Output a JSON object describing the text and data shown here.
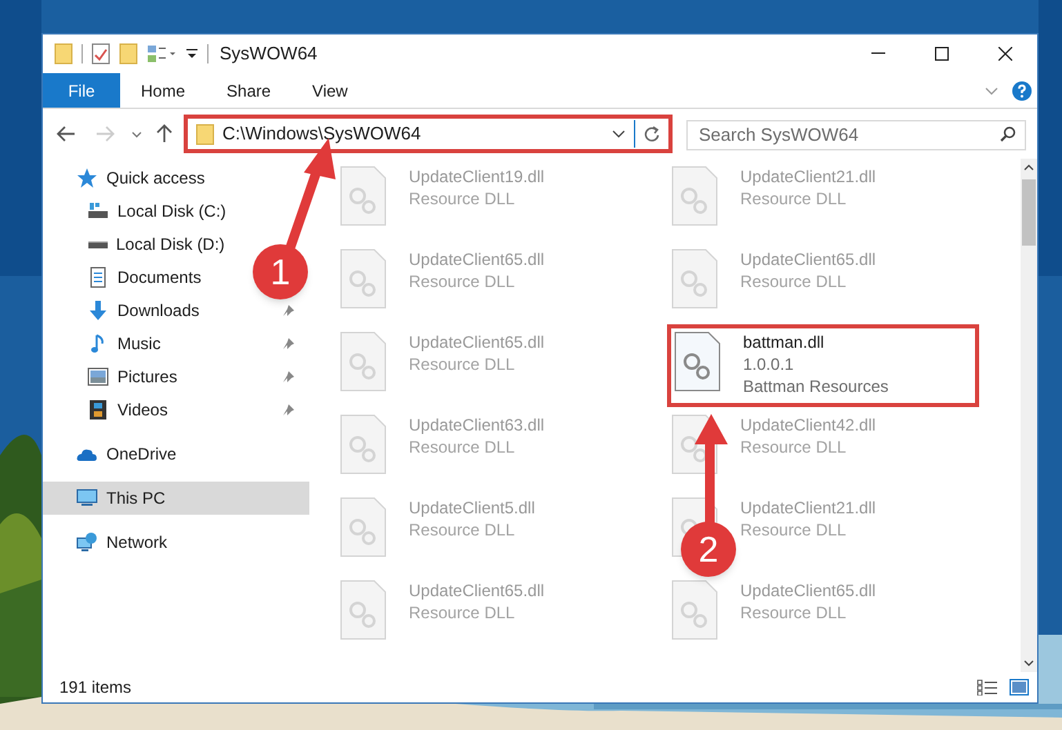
{
  "window": {
    "title": "SysWOW64"
  },
  "ribbon_tabs": [
    {
      "label": "File",
      "kind": "menu"
    },
    {
      "label": "Home",
      "kind": "tab"
    },
    {
      "label": "Share",
      "kind": "tab"
    },
    {
      "label": "View",
      "kind": "tab"
    }
  ],
  "address": {
    "path": "C:\\Windows\\SysWOW64",
    "highlighted": true
  },
  "search": {
    "placeholder": "Search SysWOW64"
  },
  "sidebar": {
    "items": [
      {
        "label": "Quick access",
        "kind": "star",
        "selected": false,
        "children": [
          {
            "label": "Local Disk (C:)",
            "kind": "system-drive",
            "pinned": false,
            "selected": false
          },
          {
            "label": "Local Disk (D:)",
            "kind": "drive",
            "pinned": false,
            "selected": false
          },
          {
            "label": "Documents",
            "kind": "documents",
            "pinned": false,
            "selected": false
          },
          {
            "label": "Downloads",
            "kind": "downloads",
            "pinned": true,
            "selected": false
          },
          {
            "label": "Music",
            "kind": "music",
            "pinned": true,
            "selected": false
          },
          {
            "label": "Pictures",
            "kind": "pictures",
            "pinned": true,
            "selected": false
          },
          {
            "label": "Videos",
            "kind": "videos",
            "pinned": true,
            "selected": false
          }
        ]
      },
      {
        "label": "OneDrive",
        "kind": "cloud",
        "selected": false
      },
      {
        "label": "This PC",
        "kind": "computer",
        "selected": true
      },
      {
        "label": "Network",
        "kind": "network",
        "selected": false
      }
    ]
  },
  "files": [
    {
      "name": "UpdateClient19.dll",
      "lines": [
        "Resource DLL"
      ],
      "faded": true,
      "highlighted": false
    },
    {
      "name": "UpdateClient21.dll",
      "lines": [
        "Resource DLL"
      ],
      "faded": true,
      "highlighted": false
    },
    {
      "name": "UpdateClient65.dll",
      "lines": [
        "Resource DLL"
      ],
      "faded": true,
      "highlighted": false
    },
    {
      "name": "UpdateClient65.dll",
      "lines": [
        "Resource DLL"
      ],
      "faded": true,
      "highlighted": false
    },
    {
      "name": "UpdateClient65.dll",
      "lines": [
        "Resource DLL"
      ],
      "faded": true,
      "highlighted": false
    },
    {
      "name": "battman.dll",
      "lines": [
        "1.0.0.1",
        "Battman Resources"
      ],
      "faded": false,
      "highlighted": true
    },
    {
      "name": "UpdateClient63.dll",
      "lines": [
        "Resource DLL"
      ],
      "faded": true,
      "highlighted": false
    },
    {
      "name": "UpdateClient42.dll",
      "lines": [
        "Resource DLL"
      ],
      "faded": true,
      "highlighted": false
    },
    {
      "name": "UpdateClient5.dll",
      "lines": [
        "Resource DLL"
      ],
      "faded": true,
      "highlighted": false
    },
    {
      "name": "UpdateClient21.dll",
      "lines": [
        "Resource DLL"
      ],
      "faded": true,
      "highlighted": false
    },
    {
      "name": "UpdateClient65.dll",
      "lines": [
        "Resource DLL"
      ],
      "faded": true,
      "highlighted": false
    },
    {
      "name": "UpdateClient65.dll",
      "lines": [
        "Resource DLL"
      ],
      "faded": true,
      "highlighted": false
    }
  ],
  "status_bar": {
    "item_count": "191 items"
  },
  "annotations": [
    {
      "label": "1"
    },
    {
      "label": "2"
    }
  ]
}
